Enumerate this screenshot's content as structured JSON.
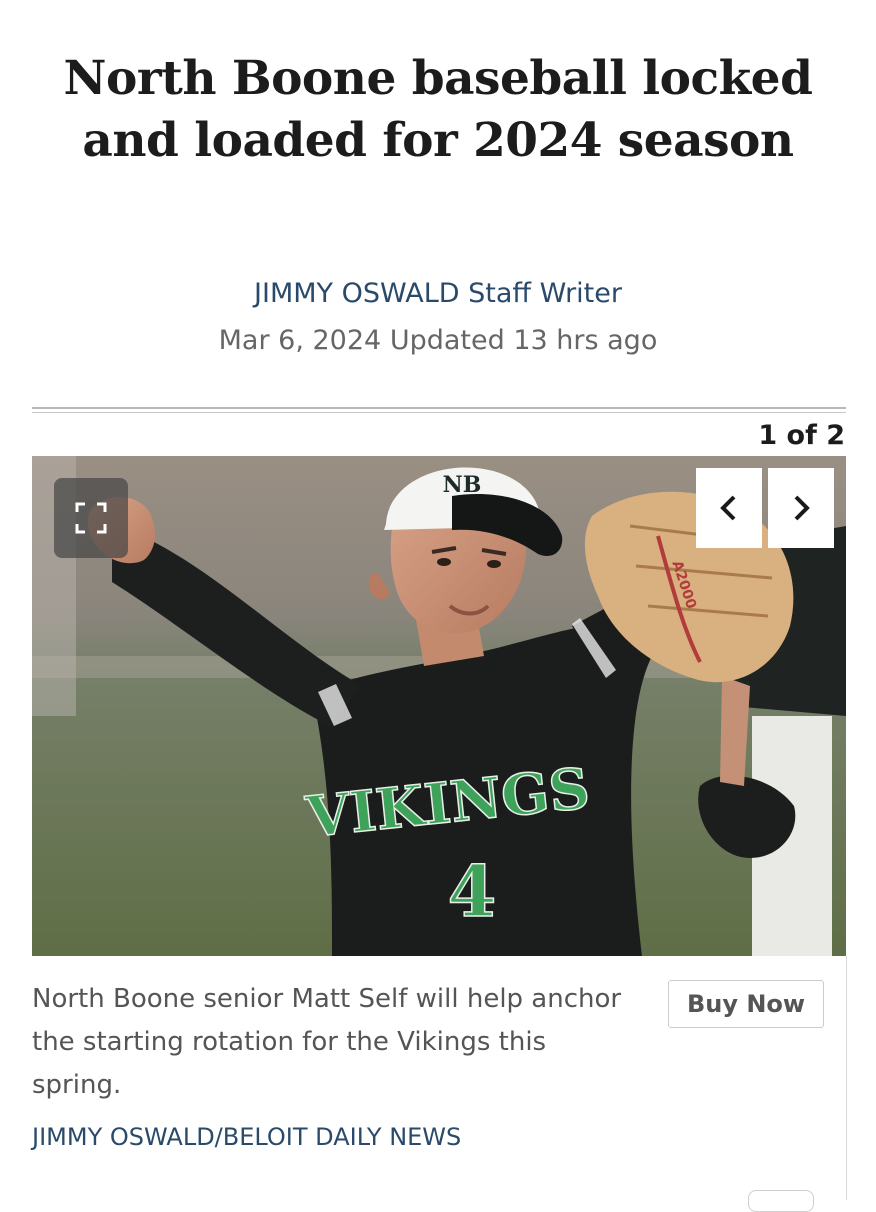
{
  "article": {
    "headline": "North Boone baseball locked and loaded for 2024 season",
    "author": "JIMMY OSWALD",
    "author_role": "Staff Writer",
    "date": "Mar 6, 2024",
    "updated": "Updated 13 hrs ago"
  },
  "gallery": {
    "counter": "1 of 2",
    "current_index": 1,
    "total": 2,
    "expand_icon": "expand-icon",
    "prev_icon": "chevron-left-icon",
    "next_icon": "chevron-right-icon",
    "caption": "North Boone senior Matt Self will help anchor the starting rotation for the Vikings this spring.",
    "credit": "JIMMY OSWALD/BELOIT DAILY NEWS",
    "buy_label": "Buy Now",
    "jersey_text": "VIKINGS",
    "jersey_number": "4",
    "cap_logo": "NB",
    "glove_brand": "A2000"
  },
  "colors": {
    "headline": "#1c1c1c",
    "byline_link": "#2a4a6b",
    "meta_text": "#666666",
    "caption_text": "#555555",
    "jersey": "#1a1d1b",
    "jersey_lettering": "#3fa25a",
    "field": "#6f7a5a"
  }
}
